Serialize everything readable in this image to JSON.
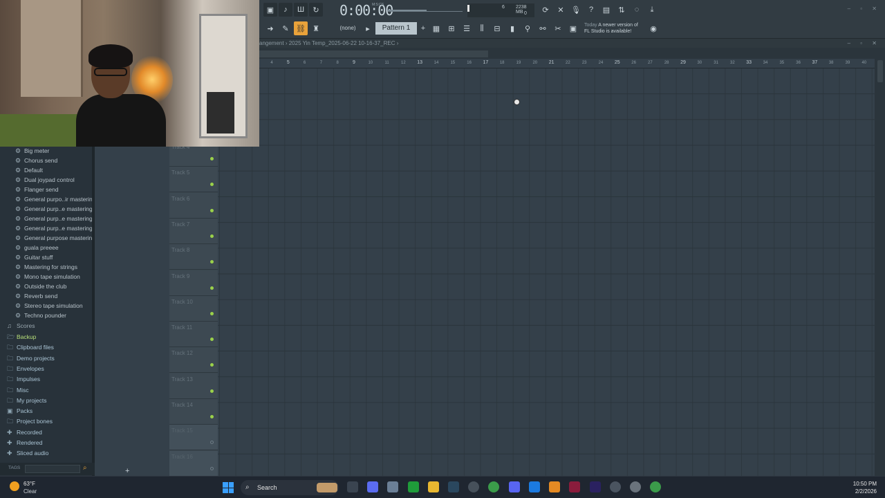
{
  "toolbar": {
    "time": "0:00:00",
    "time_unit": "M:S:CS",
    "cpu_value": "6",
    "memory": "2238 MB",
    "polyphony": "0",
    "pattern_selector": "(none)",
    "pattern_name": "Pattern 1",
    "notice_today": "Today",
    "notice_line1": "A newer version of",
    "notice_line2": "FL Studio is available!"
  },
  "titlebar": {
    "crumb": "angement",
    "separator": "›",
    "project": "2025 Yin Temp_2025-06-22 10-16-37_REC",
    "trail": "›"
  },
  "ruler": {
    "bars": [
      "4",
      "5",
      "6",
      "7",
      "8",
      "9",
      "10",
      "11",
      "12",
      "13",
      "14",
      "15",
      "16",
      "17",
      "18",
      "19",
      "20",
      "21",
      "22",
      "23",
      "24",
      "25",
      "26",
      "27",
      "28",
      "29",
      "30",
      "31",
      "32",
      "33",
      "34",
      "35",
      "36",
      "37",
      "38",
      "39",
      "40"
    ]
  },
  "browser": {
    "presets": [
      "Big meter",
      "Chorus send",
      "Default",
      "Dual joypad control",
      "Flanger send",
      "General purpo..ir mastering",
      "General purp..e mastering 2",
      "General purp..e mastering 3",
      "General purp..e mastering 4",
      "General purpose mastering",
      "guala preeee",
      "Guitar stuff",
      "Mastering for strings",
      "Mono tape simulation",
      "Outside the club",
      "Reverb send",
      "Stereo tape simulation",
      "Techno pounder"
    ],
    "scores_label": "Scores",
    "folders": [
      {
        "label": "Backup",
        "icon": "folder-open-icon"
      },
      {
        "label": "Clipboard files",
        "icon": "folder-icon"
      },
      {
        "label": "Demo projects",
        "icon": "folder-icon"
      },
      {
        "label": "Envelopes",
        "icon": "folder-icon"
      },
      {
        "label": "Impulses",
        "icon": "folder-icon"
      },
      {
        "label": "Misc",
        "icon": "folder-icon"
      },
      {
        "label": "My projects",
        "icon": "folder-icon"
      },
      {
        "label": "Packs",
        "icon": "packs-icon"
      },
      {
        "label": "Project bones",
        "icon": "folder-icon"
      },
      {
        "label": "Recorded",
        "icon": "plus-icon"
      },
      {
        "label": "Rendered",
        "icon": "plus-icon"
      },
      {
        "label": "Sliced audio",
        "icon": "plus-icon"
      }
    ],
    "tags_label": "TAGS"
  },
  "tracks": [
    {
      "name": "Track 4"
    },
    {
      "name": "Track 5"
    },
    {
      "name": "Track 6"
    },
    {
      "name": "Track 7"
    },
    {
      "name": "Track 8"
    },
    {
      "name": "Track 9"
    },
    {
      "name": "Track 10"
    },
    {
      "name": "Track 11"
    },
    {
      "name": "Track 12"
    },
    {
      "name": "Track 13"
    },
    {
      "name": "Track 14"
    },
    {
      "name": "Track 15"
    },
    {
      "name": "Track 16"
    }
  ],
  "colors": {
    "accent": "#e9a23a",
    "track_led": "#9ad14a",
    "folder_open": "#b8e07a",
    "folder": "#aac4d4"
  },
  "taskbar": {
    "temperature": "63°F",
    "condition": "Clear",
    "search_label": "Search",
    "time": "10:50 PM",
    "date": "2/2/2026"
  }
}
